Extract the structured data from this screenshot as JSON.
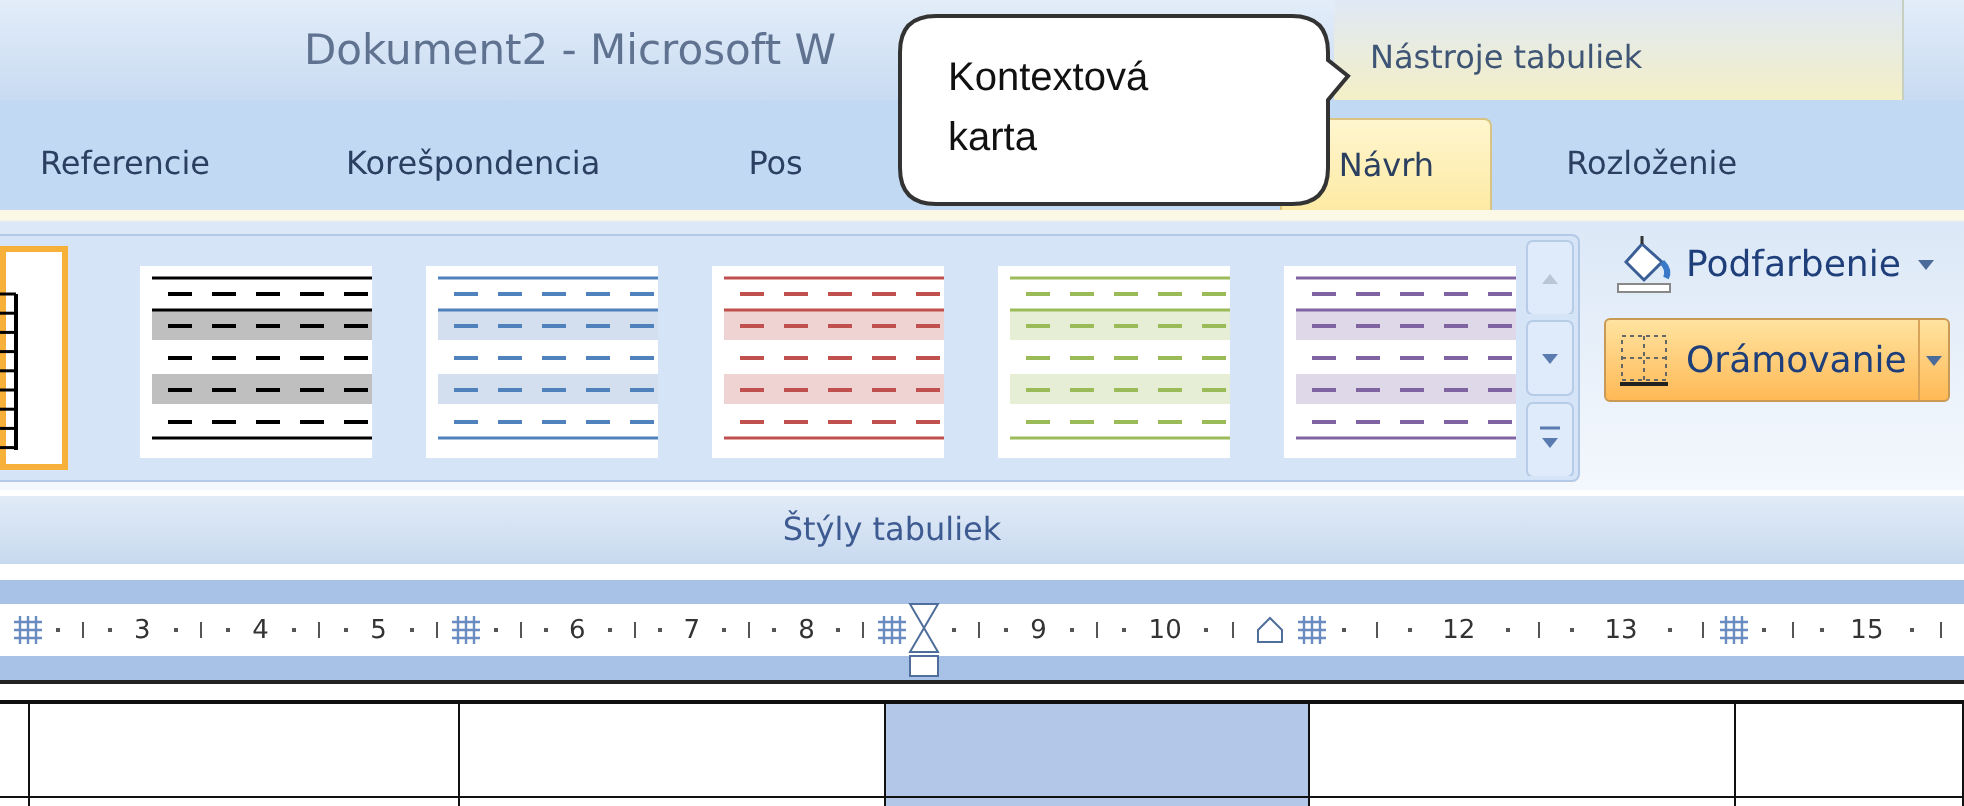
{
  "window": {
    "title": "Dokument2 - Microsoft W"
  },
  "context_header": {
    "label": "Nástroje tabuliek"
  },
  "tabs": [
    {
      "label": "Referencie",
      "selected": false
    },
    {
      "label": "Korešpondencia",
      "selected": false
    },
    {
      "label": "Pos",
      "selected": false
    },
    {
      "label": "Návrh",
      "selected": true
    },
    {
      "label": "Rozloženie",
      "selected": false
    }
  ],
  "callout": {
    "text": "Kontextová karta"
  },
  "gallery": {
    "styles": [
      {
        "kind": "grid",
        "color": "#000000",
        "selected": true
      },
      {
        "kind": "banded",
        "color": "#000000",
        "selected": false
      },
      {
        "kind": "banded",
        "color": "#4f81bd",
        "selected": false
      },
      {
        "kind": "banded",
        "color": "#c0504d",
        "selected": false
      },
      {
        "kind": "banded",
        "color": "#9bbb59",
        "selected": false
      },
      {
        "kind": "banded",
        "color": "#8064a2",
        "selected": false
      }
    ],
    "group_label": "Štýly tabuliek"
  },
  "buttons": [
    {
      "kind": "shading",
      "label": "Podfarbenie",
      "highlighted": false
    },
    {
      "kind": "borders",
      "label": "Orámovanie",
      "highlighted": true
    }
  ],
  "ruler": {
    "segments": [
      {
        "numbers": [
          "3",
          "4",
          "5"
        ]
      },
      {
        "numbers": [
          "6",
          "7",
          "8"
        ]
      },
      {
        "numbers": [
          "9",
          "10"
        ]
      },
      {
        "numbers": [
          "12",
          "13"
        ]
      },
      {
        "numbers": [
          "15"
        ]
      }
    ]
  },
  "table": {
    "rows": [
      {
        "cells": [
          {
            "selected": false
          },
          {
            "selected": false
          },
          {
            "selected": false
          },
          {
            "selected": true
          },
          {
            "selected": false
          },
          {
            "selected": false
          }
        ]
      },
      {
        "cells": [
          {
            "selected": false
          },
          {
            "selected": false
          },
          {
            "selected": false
          },
          {
            "selected": true
          },
          {
            "selected": false
          },
          {
            "selected": false
          }
        ]
      }
    ]
  }
}
